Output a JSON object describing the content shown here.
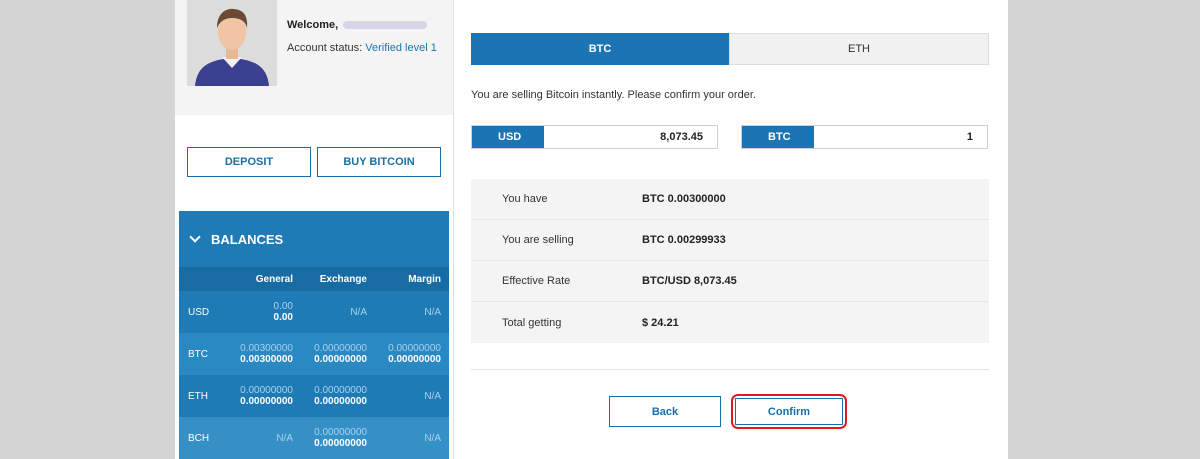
{
  "profile": {
    "welcome_label": "Welcome,",
    "account_status_label": "Account status:",
    "account_status_value": "Verified level 1"
  },
  "actions": {
    "deposit_label": "DEPOSIT",
    "buy_label": "BUY BITCOIN"
  },
  "balances": {
    "title": "BALANCES",
    "columns": [
      "General",
      "Exchange",
      "Margin"
    ],
    "rows": [
      {
        "asset": "USD",
        "general_top": "0.00",
        "general_bottom": "0.00",
        "exchange_top": "N/A",
        "exchange_bottom": "",
        "margin_top": "N/A",
        "margin_bottom": ""
      },
      {
        "asset": "BTC",
        "general_top": "0.00300000",
        "general_bottom": "0.00300000",
        "exchange_top": "0.00000000",
        "exchange_bottom": "0.00000000",
        "margin_top": "0.00000000",
        "margin_bottom": "0.00000000"
      },
      {
        "asset": "ETH",
        "general_top": "0.00000000",
        "general_bottom": "0.00000000",
        "exchange_top": "0.00000000",
        "exchange_bottom": "0.00000000",
        "margin_top": "N/A",
        "margin_bottom": ""
      },
      {
        "asset": "BCH",
        "general_top": "N/A",
        "general_bottom": "",
        "exchange_top": "0.00000000",
        "exchange_bottom": "0.00000000",
        "margin_top": "N/A",
        "margin_bottom": ""
      }
    ]
  },
  "tabs": [
    {
      "label": "BTC",
      "active": true
    },
    {
      "label": "ETH",
      "active": false
    }
  ],
  "order": {
    "message": "You are selling Bitcoin instantly. Please confirm your order.",
    "usd_label": "USD",
    "usd_value": "8,073.45",
    "btc_label": "BTC",
    "btc_value": "1"
  },
  "summary": [
    {
      "label": "You have",
      "value": "BTC 0.00300000"
    },
    {
      "label": "You are selling",
      "value": "BTC 0.00299933"
    },
    {
      "label": "Effective Rate",
      "value": "BTC/USD 8,073.45"
    },
    {
      "label": "Total getting",
      "value": "$ 24.21"
    }
  ],
  "buttons": {
    "back_label": "Back",
    "confirm_label": "Confirm"
  },
  "colors": {
    "primary": "#1a75b2",
    "highlight": "#e0191b"
  }
}
